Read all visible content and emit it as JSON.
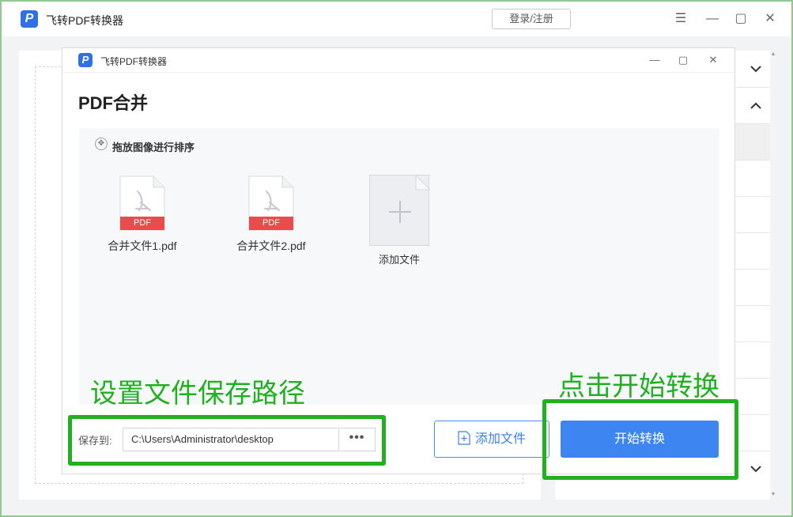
{
  "app": {
    "logo_glyph": "P",
    "title": "飞转PDF转换器",
    "login_label": "登录/注册",
    "menu_glyph": "☰",
    "minimize_glyph": "—",
    "maximize_glyph": "▢",
    "close_glyph": "✕"
  },
  "dialog": {
    "logo_glyph": "P",
    "title": "飞转PDF转换器",
    "minimize_glyph": "—",
    "maximize_glyph": "▢",
    "close_glyph": "✕",
    "heading": "PDF合并",
    "drag_hint": "拖放图像进行排序",
    "files": [
      {
        "name": "合并文件1.pdf",
        "badge": "PDF"
      },
      {
        "name": "合并文件2.pdf",
        "badge": "PDF"
      }
    ],
    "add_tile_label": "添加文件",
    "save_label": "保存到:",
    "save_path": "C:\\Users\\Administrator\\desktop",
    "browse_glyph": "•••",
    "add_file_button": "添加文件",
    "start_button": "开始转换"
  },
  "annotations": {
    "left_text": "设置文件保存路径",
    "right_text": "点击开始转换",
    "color": "#20b020"
  },
  "colors": {
    "brand": "#2f6fe8",
    "primary_button": "#3d86f2",
    "pdf_badge": "#e84c4c"
  }
}
